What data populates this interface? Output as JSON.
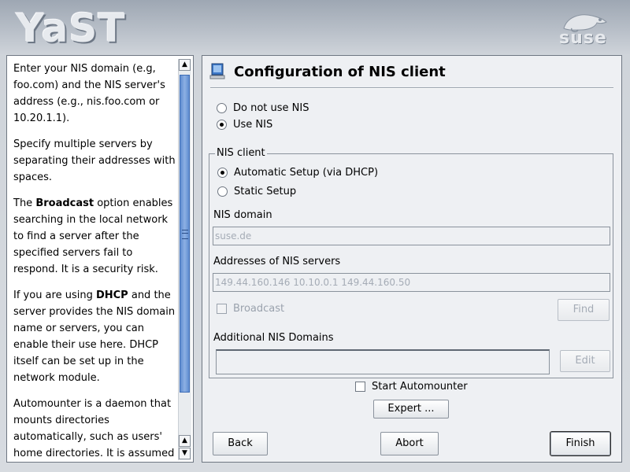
{
  "header": {
    "app_logo_text": "YaST",
    "vendor_logo_text": "suse"
  },
  "help": {
    "paragraphs": [
      "Enter your NIS domain (e.g, foo.com) and the NIS server's address (e.g., nis.foo.com or 10.20.1.1).",
      "Specify multiple servers by separating their addresses with spaces.",
      [
        "The ",
        "Broadcast",
        " option enables searching in the local network to find a server after the specified servers fail to respond. It is a security risk."
      ],
      [
        "If you are using ",
        "DHCP",
        " and the server provides the NIS domain name or servers, you can enable their use here. DHCP itself can be set up in the network module."
      ],
      "Automounter is a daemon that mounts directories automatically, such as users' home directories. It is assumed"
    ]
  },
  "main": {
    "title": "Configuration of NIS client",
    "nis_mode": {
      "options": [
        "Do not use NIS",
        "Use NIS"
      ],
      "selected": "Use NIS"
    },
    "nis_client_group": {
      "title": "NIS client",
      "setup_options": [
        "Automatic Setup (via DHCP)",
        "Static Setup"
      ],
      "selected_setup": "Automatic Setup (via DHCP)",
      "nis_domain_label": "NIS domain",
      "nis_domain_value": "suse.de",
      "servers_label": "Addresses of NIS servers",
      "servers_value": "149.44.160.146 10.10.0.1 149.44.160.50",
      "broadcast_label": "Broadcast",
      "find_label": "Find",
      "additional_domains_label": "Additional NIS Domains",
      "edit_label": "Edit"
    },
    "start_automounter_label": "Start Automounter",
    "expert_label": "Expert ...",
    "buttons": {
      "back": "Back",
      "abort": "Abort",
      "finish": "Finish"
    }
  }
}
